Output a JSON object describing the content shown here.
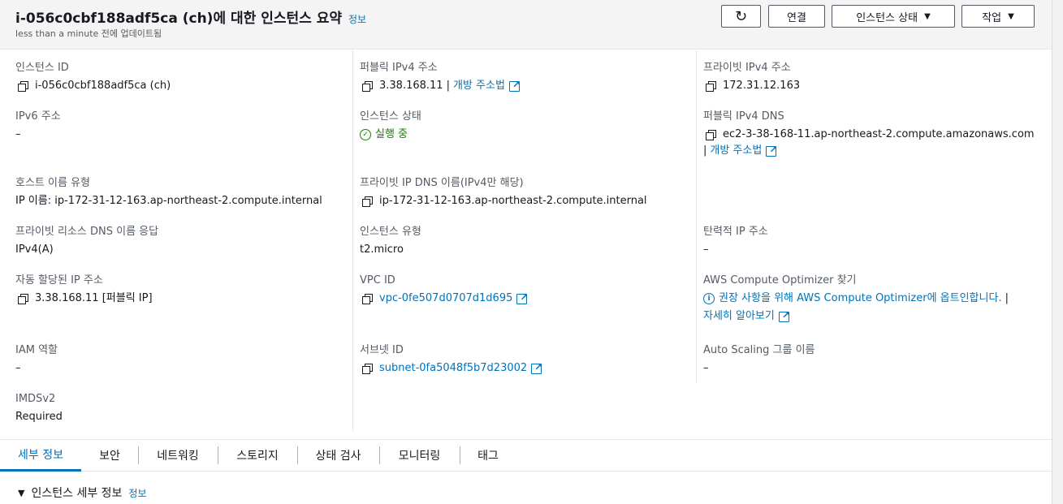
{
  "header": {
    "title": "i-056c0cbf188adf5ca (ch)에 대한 인스턴스 요약",
    "info_label": "정보",
    "updated": "less than a minute 전에 업데이트됨"
  },
  "buttons": {
    "refresh": "↻",
    "connect": "연결",
    "instance_state": "인스턴스 상태",
    "actions": "작업"
  },
  "fields": {
    "instance_id": {
      "label": "인스턴스 ID",
      "value": "i-056c0cbf188adf5ca (ch)"
    },
    "public_ipv4": {
      "label": "퍼블릭 IPv4 주소",
      "value": "3.38.168.11",
      "link": "개방 주소법"
    },
    "private_ipv4": {
      "label": "프라이빗 IPv4 주소",
      "value": "172.31.12.163"
    },
    "ipv6": {
      "label": "IPv6 주소",
      "value": "–"
    },
    "instance_state": {
      "label": "인스턴스 상태",
      "value": "실행 중"
    },
    "public_dns": {
      "label": "퍼블릭 IPv4 DNS",
      "value": "ec2-3-38-168-11.ap-northeast-2.compute.amazonaws.com",
      "link": "개방 주소법"
    },
    "hostname_type": {
      "label": "호스트 이름 유형",
      "value": "IP 이름: ip-172-31-12-163.ap-northeast-2.compute.internal"
    },
    "private_dns": {
      "label": "프라이빗 IP DNS 이름(IPv4만 해당)",
      "value": "ip-172-31-12-163.ap-northeast-2.compute.internal"
    },
    "private_resource_dns": {
      "label": "프라이빗 리소스 DNS 이름 응답",
      "value": "IPv4(A)"
    },
    "instance_type": {
      "label": "인스턴스 유형",
      "value": "t2.micro"
    },
    "elastic_ip": {
      "label": "탄력적 IP 주소",
      "value": "–"
    },
    "auto_ip": {
      "label": "자동 할당된 IP 주소",
      "value": "3.38.168.11 [퍼블릭 IP]"
    },
    "vpc_id": {
      "label": "VPC ID",
      "value": "vpc-0fe507d0707d1d695"
    },
    "optimizer": {
      "label": "AWS Compute Optimizer 찾기",
      "value": "권장 사항을 위해 AWS Compute Optimizer에 옵트인합니다.",
      "link": "자세히 알아보기"
    },
    "iam_role": {
      "label": "IAM 역할",
      "value": "–"
    },
    "subnet_id": {
      "label": "서브넷 ID",
      "value": "subnet-0fa5048f5b7d23002"
    },
    "asg_name": {
      "label": "Auto Scaling 그룹 이름",
      "value": "–"
    },
    "imdsv2": {
      "label": "IMDSv2",
      "value": "Required"
    }
  },
  "tabs": [
    "세부 정보",
    "보안",
    "네트워킹",
    "스토리지",
    "상태 검사",
    "모니터링",
    "태그"
  ],
  "section": {
    "title": "인스턴스 세부 정보",
    "info_label": "정보"
  },
  "colors": {
    "link": "#0073bb",
    "success": "#1d8102",
    "text": "#16191f",
    "muted": "#545b64"
  }
}
